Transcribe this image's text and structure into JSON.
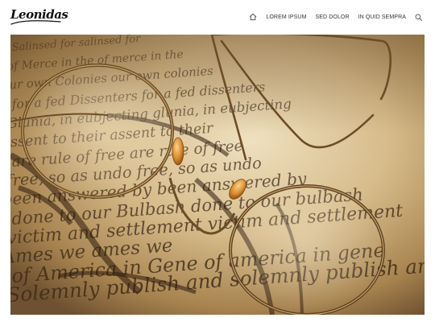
{
  "brand": {
    "name": "Leonidas"
  },
  "nav": {
    "home_icon": "home-icon",
    "items": [
      {
        "label": "LOREM IPSUM"
      },
      {
        "label": "SED DOLOR"
      },
      {
        "label": "IN QUID SEMPRA"
      }
    ],
    "search_icon": "search-icon"
  },
  "hero": {
    "image": "antique eyeglasses on handwritten document",
    "script_lines": [
      "Salinsed for",
      "of Merce in the",
      "our own Colonies",
      "for a fed Dissenters",
      "Glunia, in eubjecting",
      "assent to their",
      "are rule of free",
      "free, so as undo",
      "been answered by",
      "done to our Bulbash",
      "victim and settlement",
      "Ames we",
      "of America in Gene",
      "Solemnly publish and"
    ]
  },
  "colors": {
    "paper_light": "#e6d3ae",
    "paper_dark": "#8a6a3f",
    "ink": "#3d2a18",
    "frame": "#8a6a38",
    "nav_text": "#333333"
  }
}
